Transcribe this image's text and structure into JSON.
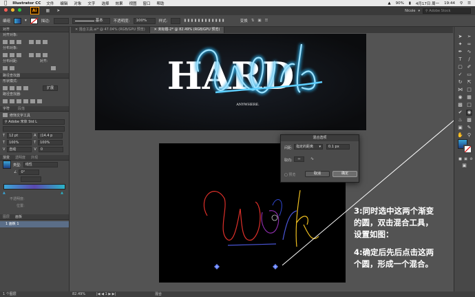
{
  "menubar": {
    "app": "Illustrator CC",
    "items": [
      "文件",
      "编辑",
      "对象",
      "文字",
      "选择",
      "效果",
      "视图",
      "窗口",
      "帮助"
    ],
    "battery": "90%",
    "datetime": "4月17日 周一",
    "time": "19:44"
  },
  "appbar": {
    "logo": "Ai",
    "workspace": "Nicole",
    "search_placeholder": "Adobe Stock"
  },
  "controlbar": {
    "selection": "编组",
    "stroke_label": "描边:",
    "stroke_style": "基本",
    "opacity_label": "不透明度:",
    "opacity_value": "100%",
    "style_label": "样式:",
    "transform_label": "变换"
  },
  "tabs": [
    {
      "label": "混合工具.ai* @ 47.04% (RGB/GPU 预览)",
      "active": false
    },
    {
      "label": "未标题-2* @ 82.49% (RGB/GPU 预览)",
      "active": true
    }
  ],
  "leftpanel": {
    "align_header": "对齐",
    "align_objects": "对齐对象:",
    "distribute_objects": "分布对象:",
    "distribute_spacing": "分布间距:",
    "align_to": "对齐:",
    "pathfinder_header": "路径查找器",
    "shape_modes": "形状模式:",
    "expand_button": "扩展",
    "pathfinders": "路径查找器:",
    "char_header": "字符",
    "para_header": "段落",
    "touch_type": "修饰文字工具",
    "font_name": "Adobe 宋体 Std L",
    "font_size": "12 pt",
    "leading": "(14.4 p",
    "scale_h": "100%",
    "scale_v": "100%",
    "kerning": "自动",
    "tracking": "0",
    "gradient_header": "渐变",
    "transparency_header": "透明度",
    "appearance_header": "外观",
    "gradient_type_label": "类型:",
    "gradient_type": "线性",
    "angle": "0°",
    "opacity_label": "不透明度:",
    "location_label": "位置:",
    "layers_tab": "图层",
    "artboards_tab": "画板",
    "layer_name": "1  画板 1"
  },
  "artboard1": {
    "word_hard": "HARD",
    "word_work": "Work",
    "subtitle": "ANYWHERE."
  },
  "artboard2": {
    "word_work": "Work"
  },
  "dialog": {
    "title": "混合选项",
    "spacing_label": "间距:",
    "spacing_option": "指定的距离",
    "spacing_value": "0.1 px",
    "orientation_label": "取向:",
    "preview_label": "预览",
    "cancel_label": "取消",
    "ok_label": "确定"
  },
  "annotation": {
    "step3_line1": "3:同时选中这两个渐变",
    "step3_line2": "的圆，双击混合工具，",
    "step3_line3": "设置如图：",
    "step4_line1": "4:确定后先后点击这两",
    "step4_line2": "个圆，形成一个混合。"
  },
  "statusbar": {
    "zoom": "82.49%",
    "page": "1",
    "tool": "混合",
    "layers_count": "1 个图层"
  },
  "colors": {
    "accent_blue": "#2aa7e0",
    "gradient_start": "#3aa6d8",
    "gradient_mid": "#5b48b0",
    "work_red": "#e0302a",
    "work_yellow": "#f0c020",
    "circle_blue": "#4a6cff"
  }
}
